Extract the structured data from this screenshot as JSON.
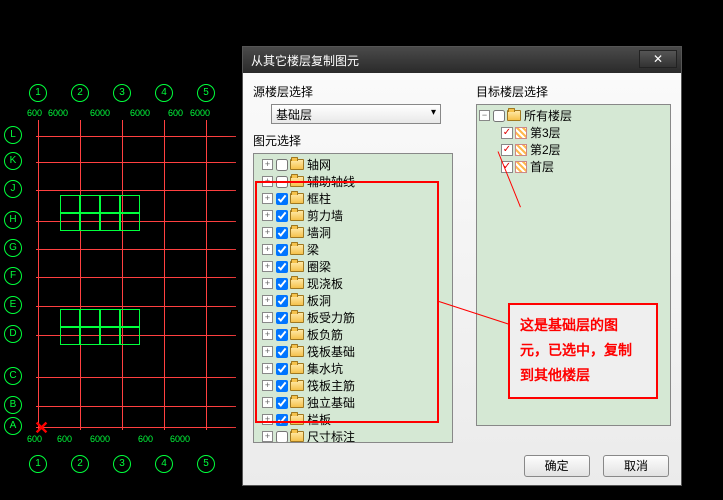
{
  "cad": {
    "col_bubbles": [
      "1",
      "2",
      "3",
      "4",
      "5"
    ],
    "row_bubbles": [
      "L",
      "K",
      "J",
      "H",
      "G",
      "F",
      "E",
      "D",
      "C",
      "B",
      "A"
    ],
    "dims_top": [
      "600",
      "6000",
      "6000",
      "6000",
      "600",
      "6000"
    ],
    "dims_bottom": [
      "600",
      "600",
      "6000",
      "600",
      "6000"
    ]
  },
  "dialog": {
    "title": "从其它楼层复制图元",
    "labels": {
      "source": "源楼层选择",
      "elements": "图元选择",
      "target": "目标楼层选择"
    },
    "source_value": "基础层",
    "element_tree": [
      {
        "label": "轴网",
        "checked": false
      },
      {
        "label": "辅助轴线",
        "checked": false
      },
      {
        "label": "框柱",
        "checked": true
      },
      {
        "label": "剪力墙",
        "checked": true
      },
      {
        "label": "墙洞",
        "checked": true
      },
      {
        "label": "梁",
        "checked": true
      },
      {
        "label": "圈梁",
        "checked": true
      },
      {
        "label": "现浇板",
        "checked": true
      },
      {
        "label": "板洞",
        "checked": true
      },
      {
        "label": "板受力筋",
        "checked": true
      },
      {
        "label": "板负筋",
        "checked": true
      },
      {
        "label": "筏板基础",
        "checked": true
      },
      {
        "label": "集水坑",
        "checked": true
      },
      {
        "label": "筏板主筋",
        "checked": true
      },
      {
        "label": "独立基础",
        "checked": true
      },
      {
        "label": "栏板",
        "checked": true
      },
      {
        "label": "尺寸标注",
        "checked": false
      }
    ],
    "target_tree": {
      "root": "所有楼层",
      "floors": [
        "第3层",
        "第2层",
        "首层"
      ]
    },
    "buttons": {
      "ok": "确定",
      "cancel": "取消"
    }
  },
  "annotation": {
    "lines": [
      "这是基础层的图",
      "元，已选中，复制",
      "到其他楼层"
    ]
  }
}
